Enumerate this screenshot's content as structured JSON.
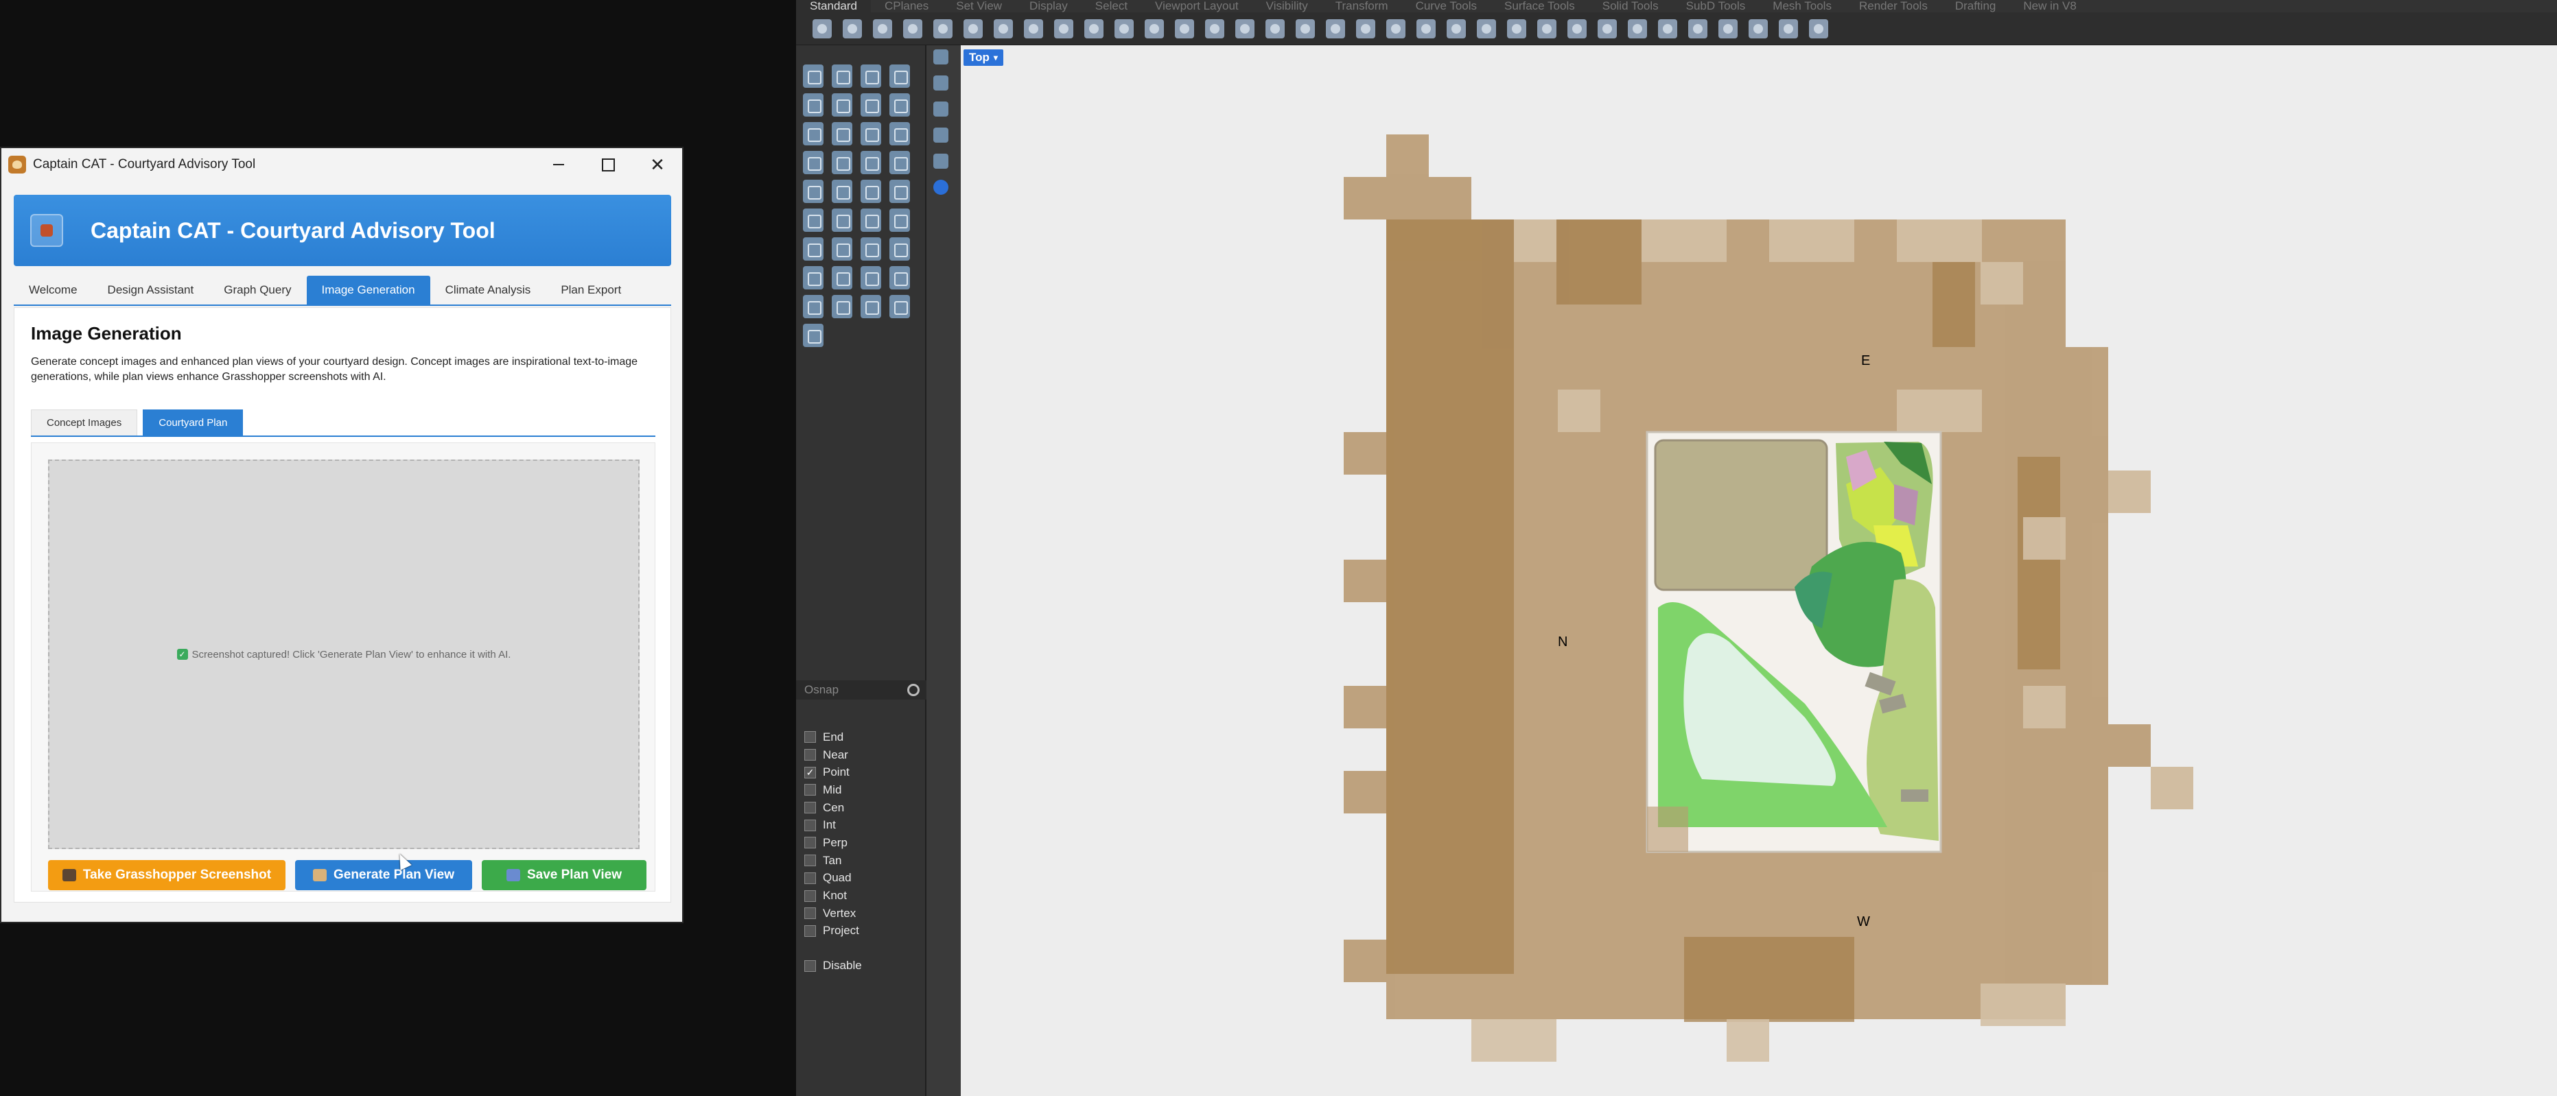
{
  "cat_window": {
    "title": "Captain CAT - Courtyard Advisory Tool",
    "header_title": "Captain CAT - Courtyard Advisory Tool",
    "tabs": [
      "Welcome",
      "Design Assistant",
      "Graph Query",
      "Image Generation",
      "Climate Analysis",
      "Plan Export"
    ],
    "active_tab": "Image Generation",
    "panel": {
      "title": "Image Generation",
      "description": "Generate concept images and enhanced plan views of your courtyard design. Concept images are inspirational text-to-image generations, while plan views enhance Grasshopper screenshots with AI.",
      "sub_tabs": [
        "Concept Images",
        "Courtyard Plan"
      ],
      "active_sub_tab": "Courtyard Plan",
      "status_message": "Screenshot captured! Click 'Generate Plan View' to enhance it with AI.",
      "buttons": {
        "screenshot": "Take Grasshopper Screenshot",
        "generate": "Generate Plan View",
        "save": "Save Plan View"
      }
    }
  },
  "rhino": {
    "ribbon_tabs": [
      "Standard",
      "CPlanes",
      "Set View",
      "Display",
      "Select",
      "Viewport Layout",
      "Visibility",
      "Transform",
      "Curve Tools",
      "Surface Tools",
      "Solid Tools",
      "SubD Tools",
      "Mesh Tools",
      "Render Tools",
      "Drafting",
      "New in V8"
    ],
    "active_ribbon_tab": "Standard",
    "viewport_name": "Top",
    "osnap": {
      "title": "Osnap",
      "items": [
        {
          "label": "End",
          "checked": false
        },
        {
          "label": "Near",
          "checked": false
        },
        {
          "label": "Point",
          "checked": true
        },
        {
          "label": "Mid",
          "checked": false
        },
        {
          "label": "Cen",
          "checked": false
        },
        {
          "label": "Int",
          "checked": false
        },
        {
          "label": "Perp",
          "checked": false
        },
        {
          "label": "Tan",
          "checked": false
        },
        {
          "label": "Quad",
          "checked": false
        },
        {
          "label": "Knot",
          "checked": false
        },
        {
          "label": "Vertex",
          "checked": false
        },
        {
          "label": "Project",
          "checked": false
        }
      ],
      "disable_label": "Disable"
    },
    "compass_labels": {
      "top": "E",
      "bottom": "W",
      "left": "N"
    }
  }
}
